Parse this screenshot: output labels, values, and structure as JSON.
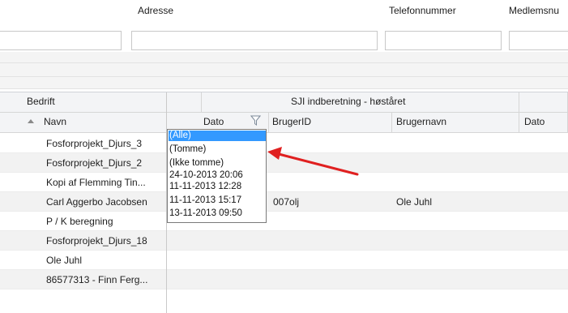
{
  "search_row": {
    "labels": {
      "address": "Adresse",
      "phone": "Telefonnummer",
      "member": "Medlemsnu"
    }
  },
  "grid": {
    "band_left": "Bedrift",
    "band_right": "SJI indberetning - høståret",
    "columns": {
      "name": "Navn",
      "date": "Dato",
      "userid": "BrugerID",
      "username": "Brugernavn",
      "date2": "Dato"
    },
    "rows": [
      {
        "name": "Fosforprojekt_Djurs_3",
        "userid": "",
        "username": ""
      },
      {
        "name": "Fosforprojekt_Djurs_2",
        "userid": "",
        "username": ""
      },
      {
        "name": "Kopi af Flemming Tin...",
        "userid": "",
        "username": ""
      },
      {
        "name": "Carl Aggerbo Jacobsen",
        "userid": "007olj",
        "username": "Ole Juhl"
      },
      {
        "name": "P / K beregning",
        "userid": "",
        "username": ""
      },
      {
        "name": "Fosforprojekt_Djurs_18",
        "userid": "",
        "username": ""
      },
      {
        "name": "Ole Juhl",
        "userid": "",
        "username": ""
      },
      {
        "name": "86577313 - Finn Ferg...",
        "userid": "",
        "username": ""
      }
    ]
  },
  "filter_dropdown": {
    "options": [
      "(Alle)",
      "(Tomme)",
      "(Ikke tomme)",
      "24-10-2013 20:06",
      "11-11-2013 12:28",
      "11-11-2013 15:17",
      "13-11-2013 09:50"
    ],
    "selected_index": 0
  },
  "annotation": {
    "color": "#e02020"
  },
  "colors": {
    "selection": "#3399ff",
    "header_bg": "#f3f4f6",
    "alt_row": "#f2f2f2"
  }
}
